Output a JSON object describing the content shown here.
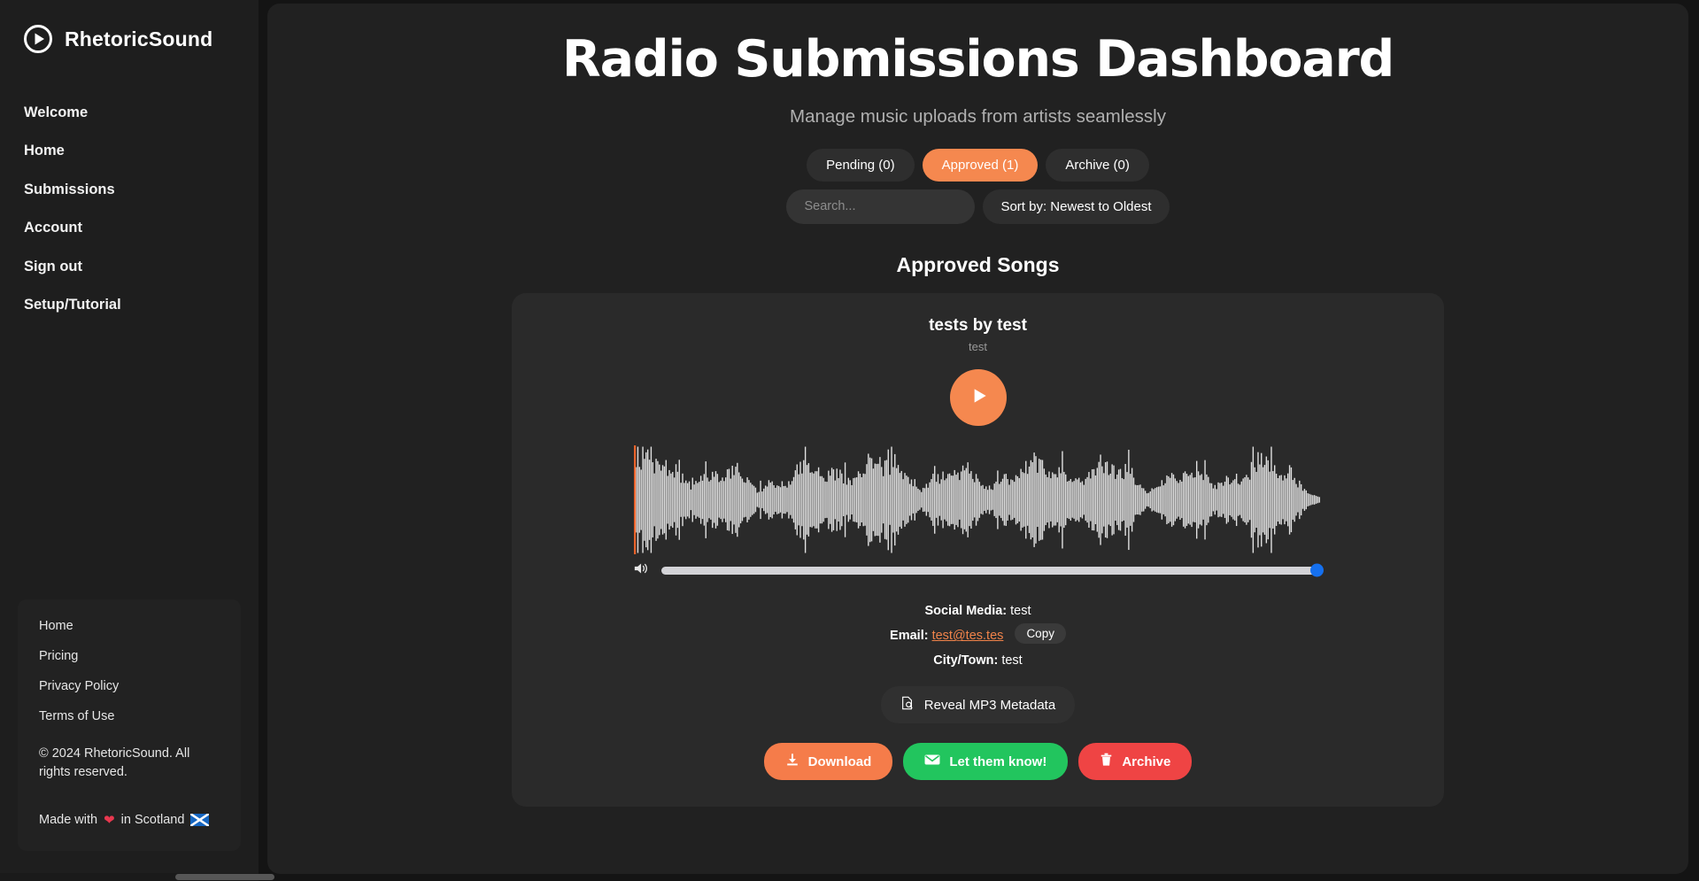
{
  "brand": {
    "name": "RhetoricSound",
    "logo_icon": "play-circle-icon"
  },
  "sidebar": {
    "nav": [
      {
        "label": "Welcome"
      },
      {
        "label": "Home"
      },
      {
        "label": "Submissions"
      },
      {
        "label": "Account"
      },
      {
        "label": "Sign out"
      },
      {
        "label": "Setup/Tutorial"
      }
    ],
    "footer": {
      "links": [
        {
          "label": "Home"
        },
        {
          "label": "Pricing"
        },
        {
          "label": "Privacy Policy"
        },
        {
          "label": "Terms of Use"
        }
      ],
      "copyright": "© 2024 RhetoricSound. All rights reserved.",
      "made_prefix": "Made with",
      "made_suffix": "in Scotland",
      "heart_icon": "heart-icon",
      "flag_icon": "scotland-flag-icon"
    }
  },
  "header": {
    "title": "Radio Submissions Dashboard",
    "subtitle": "Manage music uploads from artists seamlessly"
  },
  "tabs": [
    {
      "label": "Pending (0)",
      "active": false
    },
    {
      "label": "Approved (1)",
      "active": true
    },
    {
      "label": "Archive (0)",
      "active": false
    }
  ],
  "filters": {
    "search_value": "",
    "search_placeholder": "Search...",
    "sort_label": "Sort by: Newest to Oldest"
  },
  "section": {
    "title": "Approved Songs"
  },
  "song": {
    "title": "tests by test",
    "subtitle": "test",
    "play_icon": "play-icon",
    "volume": {
      "icon": "volume-icon",
      "value": 100
    },
    "details": [
      {
        "label": "Social Media:",
        "value": "test"
      },
      {
        "label": "City/Town:",
        "value": "test"
      }
    ],
    "email": {
      "label": "Email:",
      "value": "test@tes.tes",
      "copy_label": "Copy"
    },
    "reveal": {
      "label": "Reveal MP3 Metadata",
      "icon": "document-search-icon"
    },
    "actions": [
      {
        "label": "Download",
        "icon": "download-icon",
        "color": "#f57c4a"
      },
      {
        "label": "Let them know!",
        "icon": "envelope-icon",
        "color": "#22c55e"
      },
      {
        "label": "Archive",
        "icon": "trash-icon",
        "color": "#ef4444"
      }
    ]
  },
  "colors": {
    "accent": "#f5884f",
    "page_bg": "#212121",
    "sidebar_bg": "#1e1e1e",
    "card_bg": "#2a2a2a",
    "email_link": "#f0834a",
    "slider_thumb": "#1570ef"
  }
}
